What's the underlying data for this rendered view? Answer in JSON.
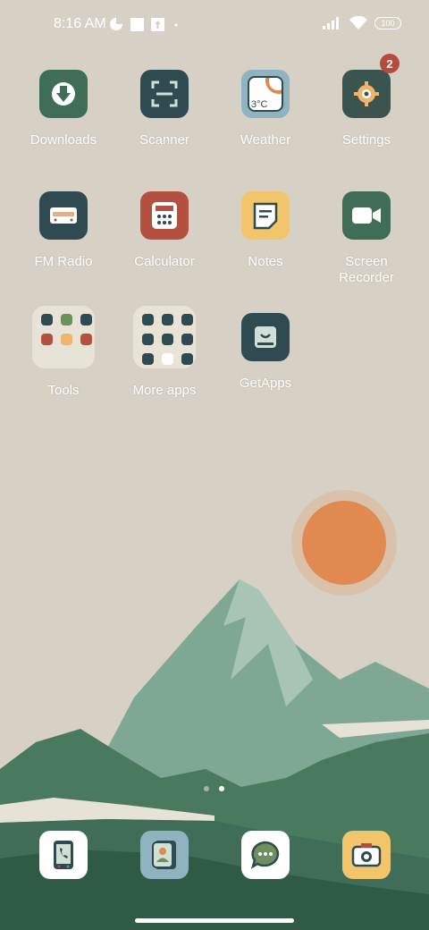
{
  "status_bar": {
    "time": "8:16 AM",
    "battery": "100",
    "icons": [
      "data-saver-icon",
      "square-icon",
      "upload-icon",
      "dot-icon",
      "signal-icon",
      "wifi-icon",
      "battery-icon"
    ]
  },
  "apps": [
    {
      "id": "downloads",
      "label": "Downloads",
      "icon": "download-icon",
      "color": "#3f6d57"
    },
    {
      "id": "scanner",
      "label": "Scanner",
      "icon": "scanner-icon",
      "color": "#2f4a50"
    },
    {
      "id": "weather",
      "label": "Weather",
      "icon": "weather-icon",
      "color": "#8fb4bf",
      "icon_text": "3°C"
    },
    {
      "id": "settings",
      "label": "Settings",
      "icon": "gear-icon",
      "color": "#3c5450",
      "badge": "2"
    },
    {
      "id": "fm-radio",
      "label": "FM Radio",
      "icon": "radio-icon",
      "color": "#2f4a50"
    },
    {
      "id": "calculator",
      "label": "Calculator",
      "icon": "calculator-icon",
      "color": "#b4503f"
    },
    {
      "id": "notes",
      "label": "Notes",
      "icon": "notes-icon",
      "color": "#f2c56b"
    },
    {
      "id": "screen-recorder",
      "label": "Screen\nRecorder",
      "label_line1": "Screen",
      "label_line2": "Recorder",
      "icon": "video-camera-icon",
      "color": "#3f6d57"
    },
    {
      "id": "tools",
      "label": "Tools",
      "icon": "folder-icon"
    },
    {
      "id": "more-apps",
      "label": "More apps",
      "icon": "folder-icon"
    },
    {
      "id": "getapps",
      "label": "GetApps",
      "icon": "store-bag-icon",
      "color": "#2f4a50"
    }
  ],
  "dock": [
    {
      "id": "phone",
      "icon": "phone-icon",
      "color": "#ffffff"
    },
    {
      "id": "contacts",
      "icon": "contacts-icon",
      "color": "#8fb4bf"
    },
    {
      "id": "messages",
      "icon": "message-icon",
      "color": "#ffffff"
    },
    {
      "id": "camera",
      "icon": "camera-icon",
      "color": "#f2c56b"
    }
  ],
  "page_indicator": {
    "pages": 2,
    "current": 2
  },
  "colors": {
    "background": "#d6d1c4",
    "sun": "#e08a52",
    "mountain": "#7fa894",
    "dark_green": "#3f6d57"
  }
}
